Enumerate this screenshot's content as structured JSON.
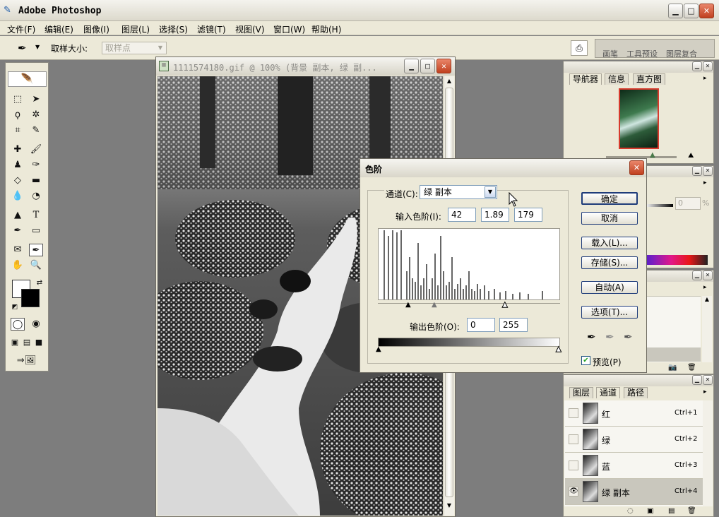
{
  "app": {
    "title": "Adobe Photoshop"
  },
  "menu": [
    "文件(F)",
    "编辑(E)",
    "图像(I)",
    "图层(L)",
    "选择(S)",
    "滤镜(T)",
    "视图(V)",
    "窗口(W)",
    "帮助(H)"
  ],
  "options": {
    "sample_label": "取样大小:",
    "sample_value": "取样点",
    "palette_tabs": [
      "画笔",
      "工具预设",
      "图层复合"
    ]
  },
  "document": {
    "title": "1111574180.gif @ 100% (背景 副本, 绿 副..."
  },
  "levels": {
    "title": "色阶",
    "channel_label": "通道(C):",
    "channel_value": "绿 副本",
    "input_label": "输入色阶(I):",
    "input_values": [
      "42",
      "1.89",
      "179"
    ],
    "output_label": "输出色阶(O):",
    "output_values": [
      "0",
      "255"
    ],
    "buttons": [
      "确定",
      "取消",
      "载入(L)...",
      "存储(S)...",
      "自动(A)",
      "选项(T)..."
    ],
    "preview_label": "预览(P)",
    "preview_checked": true
  },
  "navigator": {
    "tabs": [
      "导航器",
      "信息",
      "直方图"
    ]
  },
  "color_panel": {
    "percent_value": "0",
    "unit": "%"
  },
  "channels": {
    "tabs": [
      "图层",
      "通道",
      "路径"
    ],
    "rows": [
      {
        "name": "红",
        "shortcut": "Ctrl+1",
        "visible": false
      },
      {
        "name": "绿",
        "shortcut": "Ctrl+2",
        "visible": false
      },
      {
        "name": "蓝",
        "shortcut": "Ctrl+3",
        "visible": false
      },
      {
        "name": "绿 副本",
        "shortcut": "Ctrl+4",
        "visible": true
      }
    ]
  },
  "colors": {
    "accent": "#1f3c7a",
    "close": "#c0401f",
    "dialog_bg": "#ece9d8"
  }
}
